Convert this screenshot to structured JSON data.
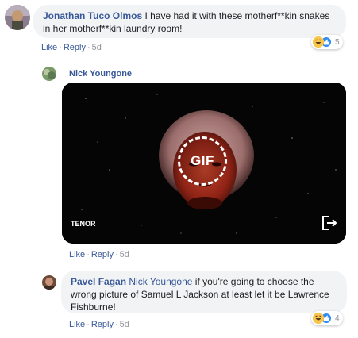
{
  "comments": [
    {
      "author": "Jonathan Tuco Olmos",
      "text": "I have had it with these motherf**kin snakes in her motherf**kin laundry room!",
      "actions": {
        "like": "Like",
        "reply": "Reply",
        "time": "5d"
      },
      "reactions": {
        "icons": [
          "haha-icon",
          "like-icon"
        ],
        "count": "5"
      }
    },
    {
      "author": "Nick Youngone",
      "gif": {
        "badge": "GIF",
        "provider": "TENOR"
      },
      "actions": {
        "like": "Like",
        "reply": "Reply",
        "time": "5d"
      }
    },
    {
      "author": "Pavel Fagan",
      "mention": "Nick Youngone",
      "text": "if you're going to choose the wrong picture of Samuel L Jackson at least let it be Lawrence Fishburne!",
      "actions": {
        "like": "Like",
        "reply": "Reply",
        "time": "5d"
      },
      "reactions": {
        "icons": [
          "haha-icon",
          "like-icon"
        ],
        "count": "4"
      }
    }
  ],
  "colors": {
    "link": "#385898",
    "bubble": "#f2f3f5",
    "meta": "#90949c",
    "like_blue": "#2e8cf6",
    "haha_yellow": "#f7c64a"
  }
}
